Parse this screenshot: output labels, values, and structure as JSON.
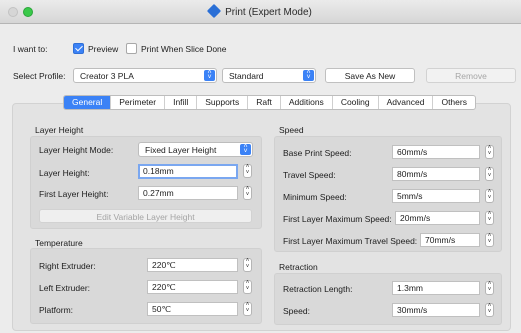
{
  "window": {
    "title": "Print (Expert Mode)"
  },
  "top": {
    "want_label": "I want to:",
    "preview_label": "Preview",
    "preview_checked": true,
    "when_done_label": "Print When Slice Done",
    "when_done_checked": false,
    "profile_label": "Select Profile:",
    "profile_value": "Creator 3 PLA",
    "quality_value": "Standard",
    "save_as_new": "Save As New",
    "remove": "Remove"
  },
  "tabs": [
    "General",
    "Perimeter",
    "Infill",
    "Supports",
    "Raft",
    "Additions",
    "Cooling",
    "Advanced",
    "Others"
  ],
  "active_tab": "General",
  "layer_height": {
    "title": "Layer Height",
    "mode_label": "Layer Height Mode:",
    "mode_value": "Fixed Layer Height",
    "height_label": "Layer Height:",
    "height_value": "0.18mm",
    "first_label": "First Layer Height:",
    "first_value": "0.27mm",
    "edit_button": "Edit Variable Layer Height"
  },
  "temperature": {
    "title": "Temperature",
    "right_label": "Right Extruder:",
    "right_value": "220℃",
    "left_label": "Left Extruder:",
    "left_value": "220℃",
    "platform_label": "Platform:",
    "platform_value": "50℃"
  },
  "speed": {
    "title": "Speed",
    "base_label": "Base Print Speed:",
    "base_value": "60mm/s",
    "travel_label": "Travel Speed:",
    "travel_value": "80mm/s",
    "min_label": "Minimum Speed:",
    "min_value": "5mm/s",
    "first_max_label": "First Layer Maximum Speed:",
    "first_max_value": "20mm/s",
    "first_travel_label": "First Layer Maximum Travel Speed:",
    "first_travel_value": "70mm/s"
  },
  "retraction": {
    "title": "Retraction",
    "length_label": "Retraction Length:",
    "length_value": "1.3mm",
    "speed_label": "Speed:",
    "speed_value": "30mm/s"
  },
  "colors": {
    "accent": "#3b82f6"
  }
}
